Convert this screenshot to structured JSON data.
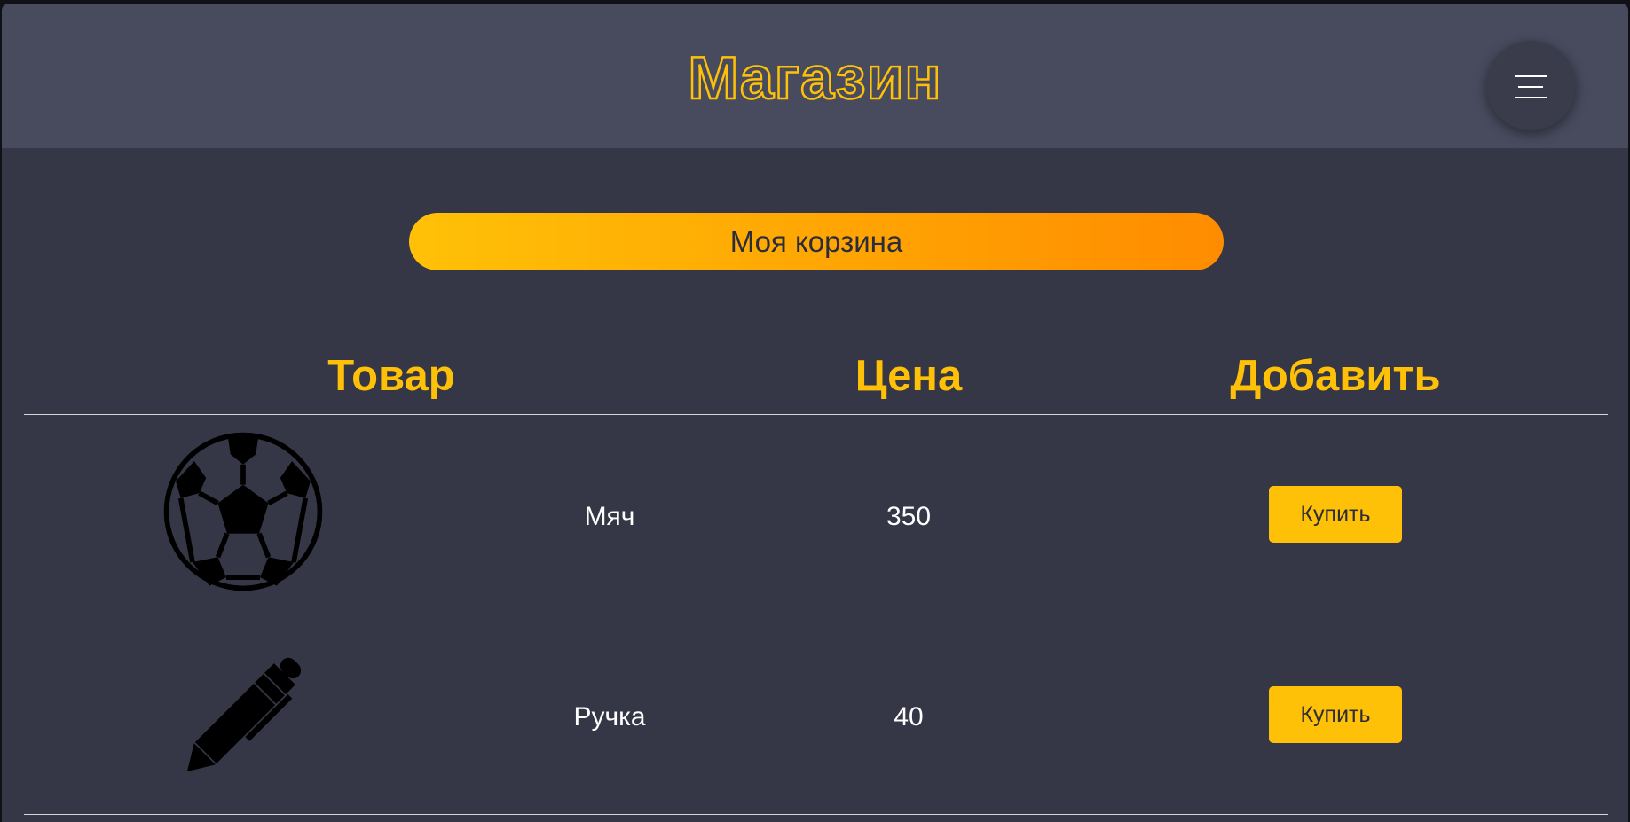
{
  "header": {
    "title": "Магазин",
    "menu_icon": "hamburger-menu-icon"
  },
  "cart": {
    "label": "Моя корзина"
  },
  "table": {
    "columns": [
      "Товар",
      "Цена",
      "Добавить"
    ],
    "rows": [
      {
        "image_icon": "soccer-ball-icon",
        "name": "Мяч",
        "price": "350",
        "buy_label": "Купить"
      },
      {
        "image_icon": "pen-icon",
        "name": "Ручка",
        "price": "40",
        "buy_label": "Купить"
      }
    ]
  },
  "colors": {
    "accent": "#ffc107",
    "accent_gradient_end": "#ff8c00",
    "header_bg": "#484b5e",
    "page_bg": "#353646",
    "text": "#ffffff"
  }
}
